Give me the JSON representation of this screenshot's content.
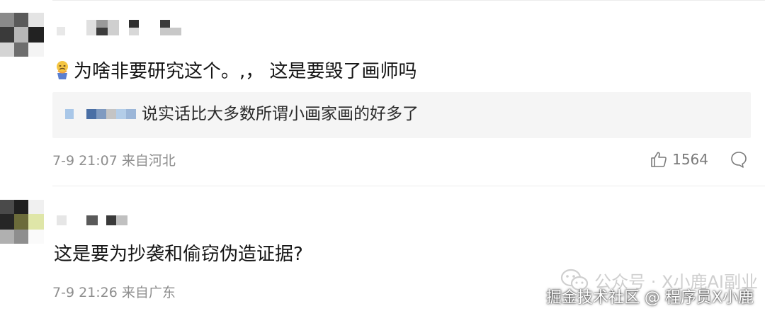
{
  "comments": [
    {
      "text": "为啥非要研究这个。,， 这是要毁了画师吗",
      "reply": {
        "text": "说实话比大多数所谓小画家画的好多了"
      },
      "meta": "7-9 21:07 来自河北",
      "likes": "1564"
    },
    {
      "text": "这是要为抄袭和偷窃伪造证据?",
      "meta": "7-9 21:26 来自广东"
    }
  ],
  "watermark": "公众号 · X小鹿AI副业",
  "credit": "掘金技术社区 @ 程序员X小鹿"
}
